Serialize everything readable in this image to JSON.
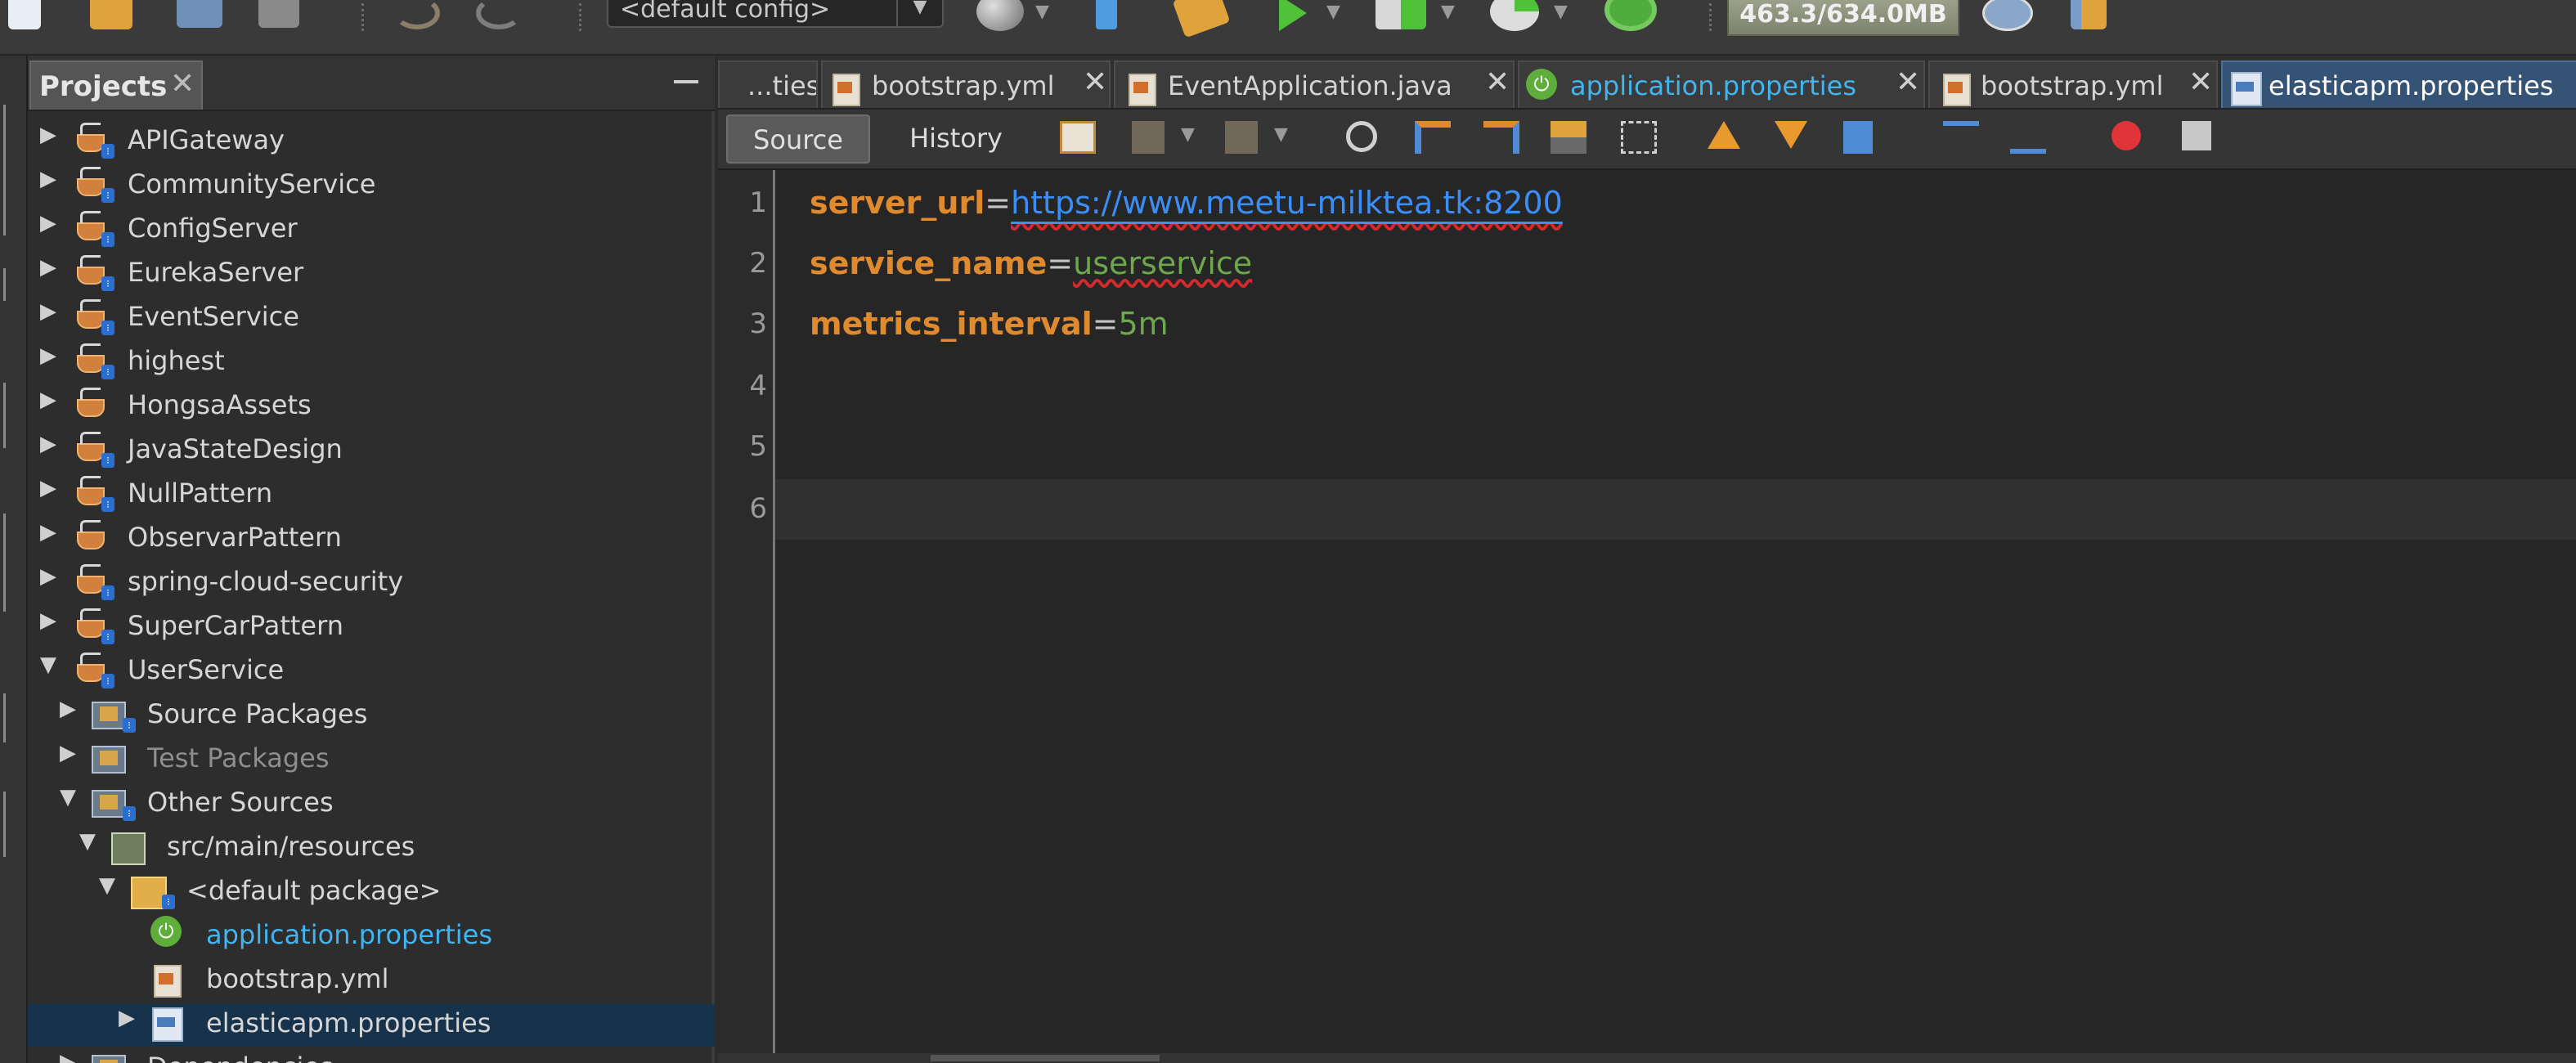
{
  "toolbar": {
    "config_value": "<default config>",
    "memory": "463.3/634.0MB"
  },
  "projects": {
    "tab_label": "Projects",
    "tree": [
      {
        "label": "APIGateway",
        "toggle": "▶",
        "icon": "maven-project-icon"
      },
      {
        "label": "CommunityService",
        "toggle": "▶",
        "icon": "maven-project-icon"
      },
      {
        "label": "ConfigServer",
        "toggle": "▶",
        "icon": "maven-project-icon"
      },
      {
        "label": "EurekaServer",
        "toggle": "▶",
        "icon": "maven-project-icon"
      },
      {
        "label": "EventService",
        "toggle": "▶",
        "icon": "maven-project-icon"
      },
      {
        "label": "highest",
        "toggle": "▶",
        "icon": "maven-project-icon"
      },
      {
        "label": "HongsaAssets",
        "toggle": "▶",
        "icon": "java-project-icon"
      },
      {
        "label": "JavaStateDesign",
        "toggle": "▶",
        "icon": "maven-project-icon"
      },
      {
        "label": "NullPattern",
        "toggle": "▶",
        "icon": "maven-project-icon"
      },
      {
        "label": "ObservarPattern",
        "toggle": "▶",
        "icon": "java-project-icon"
      },
      {
        "label": "spring-cloud-security",
        "toggle": "▶",
        "icon": "maven-project-icon"
      },
      {
        "label": "SuperCarPattern",
        "toggle": "▶",
        "icon": "maven-project-icon"
      },
      {
        "label": "UserService",
        "toggle": "▼",
        "icon": "maven-project-icon"
      },
      {
        "label": "Source Packages",
        "toggle": "▶",
        "icon": "package-folder-icon"
      },
      {
        "label": "Test Packages",
        "toggle": "▶",
        "icon": "package-folder-icon"
      },
      {
        "label": "Other Sources",
        "toggle": "▼",
        "icon": "package-folder-icon"
      },
      {
        "label": "src/main/resources",
        "toggle": "▼",
        "icon": "source-folder-icon"
      },
      {
        "label": "<default package>",
        "toggle": "▼",
        "icon": "default-package-icon"
      },
      {
        "label": "application.properties",
        "toggle": "",
        "icon": "spring-icon"
      },
      {
        "label": "bootstrap.yml",
        "toggle": "",
        "icon": "yml-file-icon"
      },
      {
        "label": "elasticapm.properties",
        "toggle": "▶",
        "icon": "properties-file-icon"
      },
      {
        "label": "Dependencies",
        "toggle": "▶",
        "icon": "package-folder-icon"
      }
    ]
  },
  "editor": {
    "tabs": [
      {
        "label": "...ties"
      },
      {
        "label": "bootstrap.yml"
      },
      {
        "label": "EventApplication.java"
      },
      {
        "label": "application.properties"
      },
      {
        "label": "bootstrap.yml"
      },
      {
        "label": "elasticapm.properties"
      }
    ],
    "source_label": "Source",
    "history_label": "History",
    "line_numbers": [
      "1",
      "2",
      "3",
      "4",
      "5",
      "6"
    ],
    "lines": [
      {
        "key": "server_url",
        "eq": "=",
        "value": "https://www.meetu-milktea.tk:8200"
      },
      {
        "key": "service_name",
        "eq": "=",
        "value": "userservice"
      },
      {
        "key": "metrics_interval",
        "eq": "=",
        "value": "5m"
      }
    ]
  },
  "colors": {
    "accent": "#42b4ee",
    "key": "#e08a2f",
    "value": "#6ea84c",
    "url": "#3b8ef5",
    "active_tab": "#355374",
    "selection": "#17334b"
  }
}
